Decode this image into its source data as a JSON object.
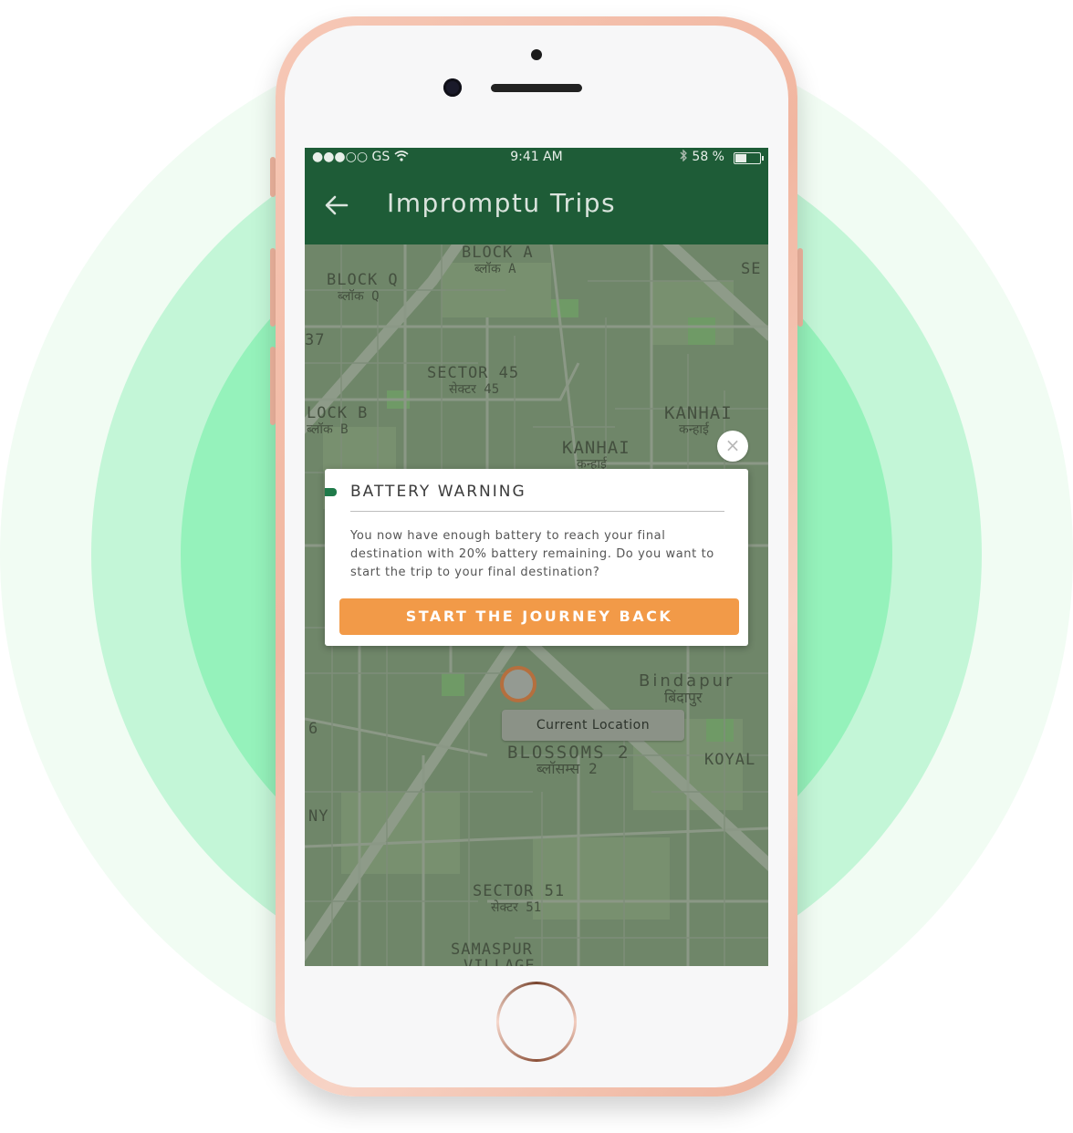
{
  "status_bar": {
    "carrier": "●●●○○ GS",
    "time": "9:41 AM",
    "battery_text": "58 %"
  },
  "app_bar": {
    "title": "Impromptu Trips"
  },
  "map": {
    "labels": {
      "block_a": "BLOCK A",
      "block_a_hi": "ब्लॉक A",
      "block_q": "BLOCK Q",
      "block_q_hi": "ब्लॉक Q",
      "num_37": "37",
      "sector_45": "SECTOR 45",
      "sector_45_hi": "सेक्टर 45",
      "block_b": "LOCK B",
      "block_b_hi": "ब्लॉक B",
      "kanhai_1": "KANHAI",
      "kanhai_1_hi": "कन्हाई",
      "kanhai_2": "KANHAI",
      "kanhai_2_hi": "कन्हाई",
      "se": "SE",
      "bindapur": "Bindapur",
      "bindapur_hi": "बिंदापुर",
      "blossoms": "BLOSSOMS 2",
      "blossoms_hi": "ब्लॉसम्स 2",
      "koyal": "KOYAL",
      "num_6": "6",
      "ny": "NY",
      "sector_51": "SECTOR 51",
      "sector_51_hi": "सेक्टर 51",
      "samaspur": "SAMASPUR",
      "village": "VILLAGE"
    },
    "current_location_label": "Current Location"
  },
  "dialog": {
    "title": "BATTERY WARNING",
    "message": "You now have enough battery to reach your final destination with 20% battery remaining. Do you want to start the trip to your final destination?",
    "cta_label": "START THE JOURNEY BACK",
    "close_label": "×"
  },
  "colors": {
    "app_bar": "#1e5c37",
    "cta": "#f29a48",
    "accent": "#1f7a4a"
  }
}
